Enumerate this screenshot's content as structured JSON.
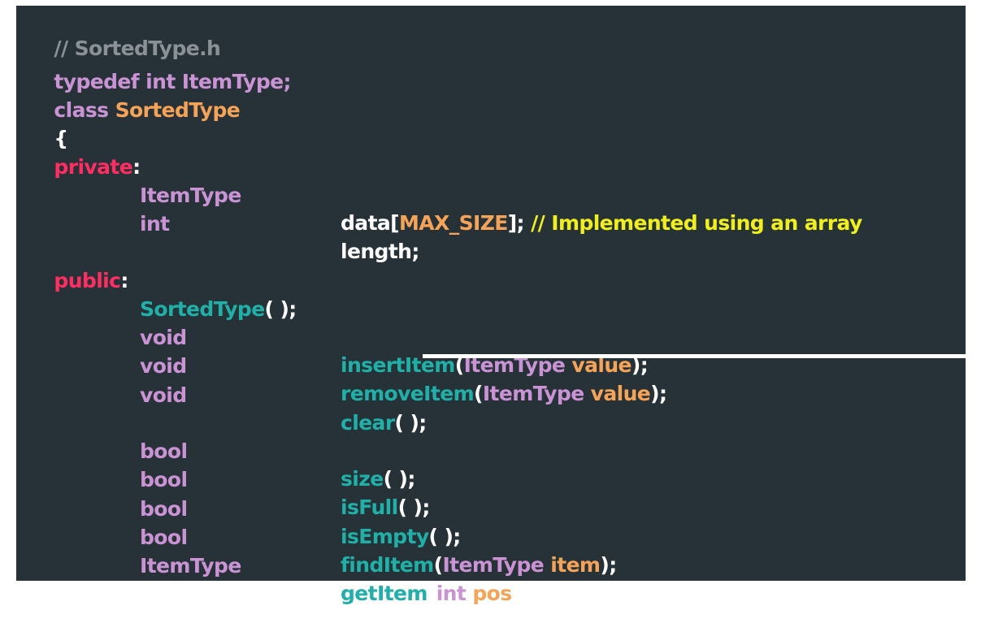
{
  "code": {
    "file_comment": "// SortedType.h",
    "typedef_line": {
      "keyword": "typedef int ItemType;"
    },
    "class_line": {
      "keyword": "class",
      "name": "SortedType"
    },
    "open_brace": "{",
    "private_label": {
      "keyword": "private",
      "colon": ":"
    },
    "members": [
      {
        "type": "ItemType",
        "name": "data[",
        "macro": "MAX_SIZE",
        "suffix": "];",
        "comment": "// Implemented using an array"
      },
      {
        "type": "int",
        "name": "length;"
      }
    ],
    "public_label": {
      "keyword": "public",
      "colon": ":"
    },
    "constructor": {
      "name": "SortedType",
      "suffix": "( );"
    },
    "methods": [
      {
        "type": "void",
        "name": "insertItem",
        "open": "(",
        "param_type": "ItemType",
        "param_name": "value",
        "close": ");"
      },
      {
        "type": "void",
        "name": "removeItem",
        "open": "(",
        "param_type": "ItemType",
        "param_name": "value",
        "close": ");"
      },
      {
        "type": "void",
        "name": "clear",
        "suffix": "( );"
      },
      {
        "type": "bool",
        "name": "size",
        "suffix": "( );"
      },
      {
        "type": "bool",
        "name": "isFull",
        "suffix": "( );"
      },
      {
        "type": "bool",
        "name": "isEmpty",
        "suffix": "( );"
      },
      {
        "type": "bool",
        "name": "findItem",
        "open": "(",
        "param_type": "ItemType",
        "param_name": "item",
        "close": ");"
      },
      {
        "type": "ItemType",
        "name": "getItem",
        "open": "(",
        "param_type": "int",
        "param_name": "pos",
        "close": ");"
      }
    ],
    "close_brace": "};"
  }
}
